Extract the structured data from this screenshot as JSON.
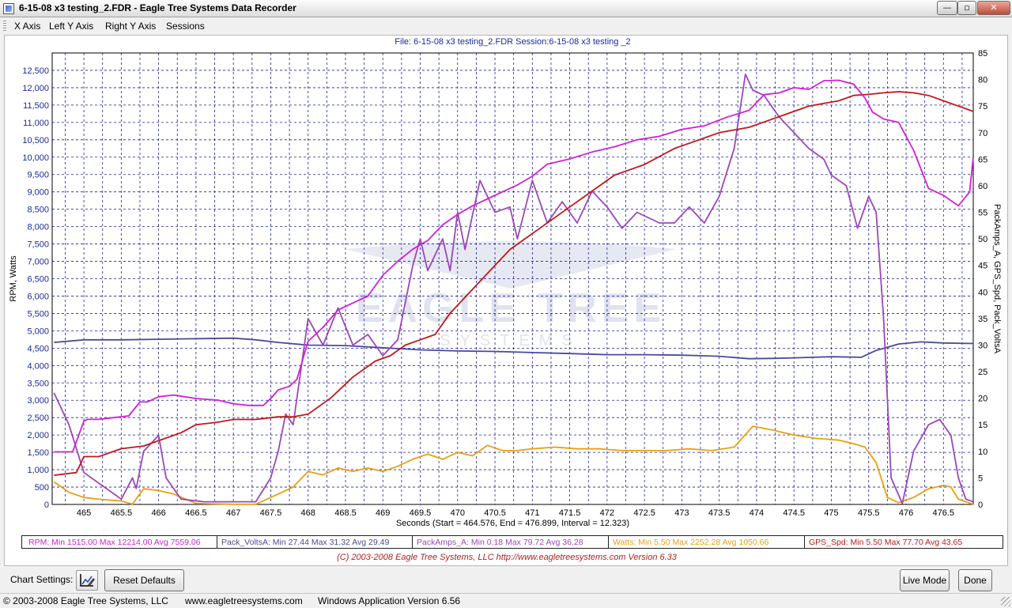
{
  "window": {
    "title": "6-15-08 x3 testing_2.FDR - Eagle Tree Systems Data Recorder",
    "min_glyph": "—",
    "max_glyph": "▫",
    "close_glyph": "✕"
  },
  "menu": [
    "X Axis",
    "Left Y Axis",
    "Right Y Axis",
    "Sessions"
  ],
  "chart_header": "File: 6-15-08 x3 testing_2.FDR   Session:6-15-08 x3 testing _2",
  "watermark": {
    "main": "EAGLE TREE",
    "sub": "SYSTEMS"
  },
  "chart_data": {
    "type": "line",
    "xlabel": "Seconds (Start = 464.576,  End = 476.899,  Interval =  12.323)",
    "ylabel_left": "RPM, Watts",
    "ylabel_right": "PackAmps_A, GPS_Spd, Pack_VoltsA",
    "xlim": [
      464.576,
      476.899
    ],
    "ylim_left": [
      0,
      13000
    ],
    "ylim_right": [
      0,
      85
    ],
    "grid": true,
    "x_ticks": [
      "465",
      "465.5",
      "466",
      "466.5",
      "467",
      "467.5",
      "468",
      "468.5",
      "469",
      "469.5",
      "470",
      "470.5",
      "471",
      "471.5",
      "472",
      "472.5",
      "473",
      "473.5",
      "474",
      "474.5",
      "475",
      "475.5",
      "476",
      "476.5"
    ],
    "y_left_ticks": [
      "0",
      "500",
      "1,000",
      "1,500",
      "2,000",
      "2,500",
      "3,000",
      "3,500",
      "4,000",
      "4,500",
      "5,000",
      "5,500",
      "6,000",
      "6,500",
      "7,000",
      "7,500",
      "8,000",
      "8,500",
      "9,000",
      "9,500",
      "10,000",
      "10,500",
      "11,000",
      "11,500",
      "12,000",
      "12,500"
    ],
    "y_right_ticks": [
      "0",
      "5",
      "10",
      "15",
      "20",
      "25",
      "30",
      "35",
      "40",
      "45",
      "50",
      "55",
      "60",
      "65",
      "70",
      "75",
      "80",
      "85"
    ],
    "series": [
      {
        "name": "RPM",
        "axis": "left",
        "color": "#d020d8",
        "x": [
          464.6,
          464.7,
          464.85,
          465.0,
          465.05,
          465.2,
          465.4,
          465.6,
          465.75,
          465.85,
          466.0,
          466.2,
          466.35,
          466.5,
          466.8,
          467.0,
          467.2,
          467.4,
          467.5,
          467.6,
          467.75,
          467.85,
          468.0,
          468.2,
          468.4,
          468.6,
          468.8,
          469.0,
          469.2,
          469.4,
          469.6,
          469.8,
          470.0,
          470.2,
          470.4,
          470.6,
          470.8,
          471.0,
          471.2,
          471.5,
          471.8,
          472.1,
          472.4,
          472.7,
          473.0,
          473.3,
          473.6,
          473.9,
          474.1,
          474.3,
          474.5,
          474.7,
          474.9,
          475.1,
          475.3,
          475.45,
          475.55,
          475.7,
          475.9,
          476.1,
          476.3,
          476.5,
          476.7,
          476.85,
          476.9
        ],
        "values": [
          1515,
          1515,
          1515,
          2400,
          2450,
          2450,
          2500,
          2550,
          2950,
          2950,
          3100,
          3150,
          3100,
          3050,
          3000,
          2900,
          2850,
          2850,
          3050,
          3300,
          3400,
          3600,
          4700,
          5100,
          5600,
          5800,
          6000,
          6600,
          7000,
          7350,
          7600,
          8050,
          8350,
          8600,
          8800,
          9000,
          9200,
          9450,
          9800,
          9950,
          10150,
          10300,
          10500,
          10600,
          10800,
          10900,
          11150,
          11350,
          11800,
          11850,
          12000,
          11950,
          12200,
          12214,
          12100,
          11700,
          11300,
          11100,
          11000,
          10200,
          9100,
          8900,
          8600,
          9000,
          10000
        ]
      },
      {
        "name": "Pack_VoltsA",
        "axis": "right",
        "color": "#4a4a98",
        "x": [
          464.6,
          465.0,
          465.5,
          466.0,
          466.5,
          467.0,
          467.3,
          467.6,
          468.0,
          468.5,
          469.0,
          469.5,
          470.0,
          470.5,
          471.0,
          471.5,
          472.0,
          472.5,
          473.0,
          473.5,
          473.9,
          474.2,
          474.5,
          475.0,
          475.4,
          475.6,
          475.9,
          476.2,
          476.5,
          476.9
        ],
        "values": [
          30.5,
          31.0,
          31.0,
          31.1,
          31.2,
          31.3,
          31.0,
          30.5,
          30.0,
          29.9,
          29.5,
          29.1,
          28.9,
          28.8,
          28.6,
          28.4,
          28.2,
          28.2,
          28.1,
          27.9,
          27.44,
          27.5,
          27.6,
          27.8,
          27.7,
          29.0,
          30.2,
          30.6,
          30.4,
          30.3
        ]
      },
      {
        "name": "PackAmps_A",
        "axis": "right",
        "color": "#9a48b8",
        "x": [
          464.6,
          464.8,
          465.0,
          465.2,
          465.5,
          465.65,
          465.7,
          465.8,
          466.0,
          466.1,
          466.3,
          466.6,
          467.0,
          467.3,
          467.5,
          467.6,
          467.7,
          467.8,
          468.0,
          468.2,
          468.4,
          468.6,
          468.8,
          469.0,
          469.2,
          469.4,
          469.5,
          469.6,
          469.7,
          469.8,
          469.9,
          470.0,
          470.1,
          470.3,
          470.5,
          470.7,
          470.8,
          471.0,
          471.2,
          471.4,
          471.6,
          471.8,
          472.0,
          472.2,
          472.4,
          472.7,
          472.9,
          473.1,
          473.3,
          473.5,
          473.7,
          473.85,
          473.95,
          474.1,
          474.3,
          474.5,
          474.7,
          474.9,
          475.0,
          475.2,
          475.35,
          475.5,
          475.6,
          475.7,
          475.8,
          475.95,
          476.1,
          476.3,
          476.45,
          476.6,
          476.7,
          476.8,
          476.9
        ],
        "values": [
          21,
          15,
          6,
          4,
          1,
          5,
          3,
          10,
          13,
          5,
          1,
          0.5,
          0.5,
          0.5,
          5,
          10,
          17,
          15,
          35,
          30,
          37,
          30,
          32,
          28,
          31,
          45,
          50,
          44,
          47,
          50,
          44,
          55,
          48,
          61,
          55,
          56,
          50,
          61,
          53,
          57,
          53,
          59,
          56,
          52,
          55,
          53,
          53,
          56,
          53,
          58,
          67,
          81,
          78,
          77,
          73,
          70,
          67,
          65,
          62,
          60,
          52,
          58,
          55,
          35,
          5,
          0.18,
          10,
          15,
          16,
          13,
          5,
          1,
          0.5
        ]
      },
      {
        "name": "Watts",
        "axis": "left",
        "color": "#e8a010",
        "x": [
          464.6,
          464.8,
          465.0,
          465.2,
          465.5,
          465.65,
          465.8,
          466.0,
          466.2,
          466.5,
          467.0,
          467.3,
          467.6,
          467.8,
          468.0,
          468.2,
          468.4,
          468.6,
          468.8,
          469.0,
          469.2,
          469.4,
          469.6,
          469.8,
          470.0,
          470.2,
          470.4,
          470.6,
          470.8,
          471.0,
          471.3,
          471.6,
          471.9,
          472.2,
          472.5,
          472.8,
          473.1,
          473.4,
          473.7,
          473.95,
          474.2,
          474.5,
          474.8,
          475.1,
          475.3,
          475.45,
          475.6,
          475.75,
          475.9,
          476.1,
          476.3,
          476.5,
          476.6,
          476.7,
          476.9
        ],
        "values": [
          650,
          350,
          200,
          150,
          100,
          10,
          450,
          400,
          300,
          30,
          5.5,
          5.5,
          300,
          500,
          950,
          850,
          1050,
          950,
          1050,
          950,
          1100,
          1300,
          1450,
          1300,
          1500,
          1400,
          1700,
          1550,
          1550,
          1600,
          1650,
          1600,
          1600,
          1550,
          1550,
          1550,
          1600,
          1550,
          1650,
          2252,
          2150,
          2000,
          1900,
          1850,
          1750,
          1650,
          1200,
          200,
          50,
          200,
          450,
          550,
          500,
          150,
          5.5
        ]
      },
      {
        "name": "GPS_Spd",
        "axis": "right",
        "color": "#c01818",
        "x": [
          464.6,
          464.9,
          465.0,
          465.2,
          465.5,
          465.8,
          466.0,
          466.3,
          466.5,
          466.8,
          467.0,
          467.3,
          467.6,
          467.8,
          468.0,
          468.3,
          468.6,
          468.9,
          469.1,
          469.3,
          469.5,
          469.7,
          469.9,
          470.1,
          470.3,
          470.5,
          470.7,
          470.9,
          471.1,
          471.3,
          471.5,
          471.7,
          471.9,
          472.1,
          472.3,
          472.5,
          472.7,
          472.9,
          473.1,
          473.3,
          473.5,
          473.7,
          473.9,
          474.1,
          474.3,
          474.5,
          474.7,
          474.9,
          475.1,
          475.3,
          475.5,
          475.7,
          475.9,
          476.1,
          476.3,
          476.5,
          476.7,
          476.9
        ],
        "values": [
          5.5,
          6,
          9,
          9,
          10.5,
          11,
          12,
          13.5,
          15,
          15.5,
          16,
          16,
          16.5,
          16.5,
          17,
          20,
          24,
          27,
          28,
          30,
          31,
          32,
          36,
          39,
          42,
          45,
          48,
          50,
          52,
          54,
          56,
          58,
          60,
          62,
          63,
          64,
          65.5,
          67,
          68,
          69,
          70,
          70.5,
          71,
          72,
          73,
          74,
          75,
          75.5,
          76,
          77,
          77.2,
          77.5,
          77.7,
          77.5,
          77,
          76,
          75,
          74
        ]
      }
    ]
  },
  "legend": [
    {
      "name": "RPM:",
      "min": "Min 1515.00",
      "max": "Max 12214.00",
      "avg": "Avg 7559.06",
      "color": "#d020d8"
    },
    {
      "name": "Pack_VoltsA:",
      "min": "Min 27.44",
      "max": "Max 31.32",
      "avg": "Avg 29.49",
      "color": "#4a4a98"
    },
    {
      "name": "PackAmps_A:",
      "min": "Min 0.18",
      "max": "Max 79.72",
      "avg": "Avg 36.28",
      "color": "#9a48b8"
    },
    {
      "name": "Watts:",
      "min": "Min 5.50",
      "max": "Max 2252.28",
      "avg": "Avg 1050.66",
      "color": "#e8a010"
    },
    {
      "name": "GPS_Spd:",
      "min": "Min 5.50",
      "max": "Max 77.70",
      "avg": "Avg 43.65",
      "color": "#c01818"
    }
  ],
  "chart_copyright": "(C) 2003-2008 Eagle Tree Systems, LLC     http://www.eagletreesystems.com     Version 6.33",
  "settings": {
    "label": "Chart Settings:",
    "reset": "Reset Defaults",
    "live": "Live Mode",
    "done": "Done"
  },
  "status": [
    "© 2003-2008 Eagle Tree Systems, LLC",
    "www.eagletreesystems.com",
    "Windows Application Version 6.56"
  ]
}
